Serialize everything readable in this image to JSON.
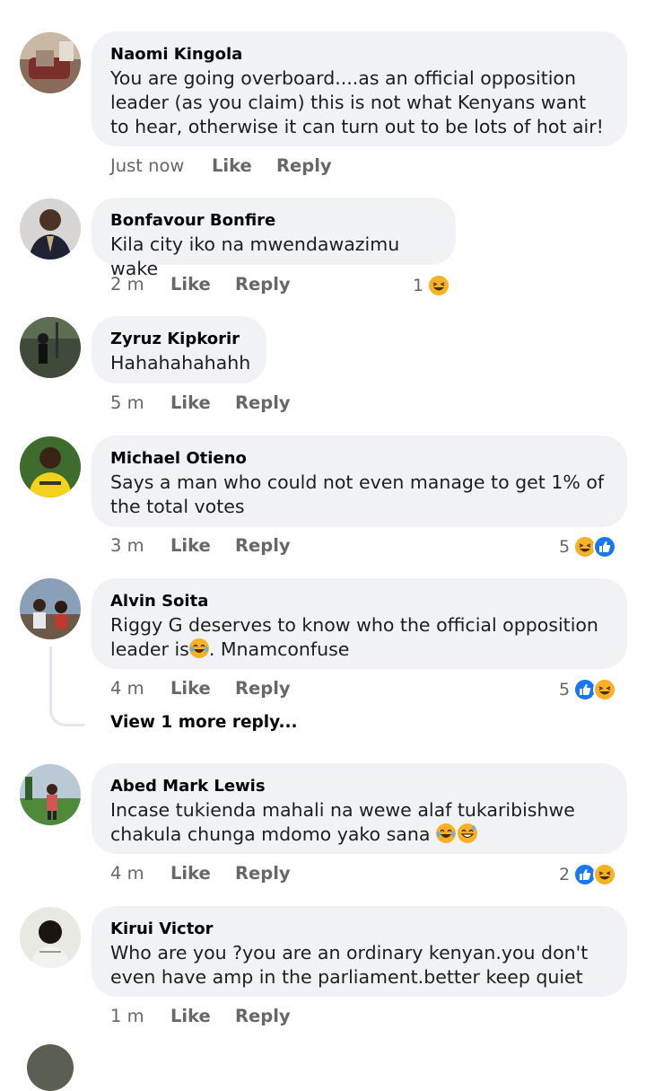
{
  "comments": [
    {
      "author": "Naomi Kingola",
      "text": "You are going overboard....as an official opposition leader (as you claim) this is not what Kenyans want to hear, otherwise it can turn out to be lots of hot air!",
      "time": "Just now",
      "like": "Like",
      "reply": "Reply"
    },
    {
      "author": "Bonfavour Bonfire",
      "text": "Kila city iko na mwendawazimu wake",
      "time": "2 m",
      "like": "Like",
      "reply": "Reply",
      "reaction_count": "1"
    },
    {
      "author": "Zyruz Kipkorir",
      "text": "Hahahahahahh",
      "time": "5 m",
      "like": "Like",
      "reply": "Reply"
    },
    {
      "author": "Michael Otieno",
      "text": "Says a man who could not even manage to get 1% of the total votes",
      "time": "3 m",
      "like": "Like",
      "reply": "Reply",
      "reaction_count": "5"
    },
    {
      "author": "Alvin Soita",
      "text_before_emoji": "Riggy G deserves to know who the official opposition leader is",
      "text_after_emoji": ". Mnamconfuse",
      "time": "4 m",
      "like": "Like",
      "reply": "Reply",
      "reaction_count": "5",
      "view_more": "View 1 more reply..."
    },
    {
      "author": "Abed Mark Lewis",
      "text": "Incase tukienda mahali na wewe alaf tukaribishwe chakula chunga mdomo yako sana ",
      "time": "4 m",
      "like": "Like",
      "reply": "Reply",
      "reaction_count": "2"
    },
    {
      "author": "Kirui Victor",
      "text": "Who are you ?you are an ordinary kenyan.you don't even have amp in the parliament.better keep quiet",
      "time": "1 m",
      "like": "Like",
      "reply": "Reply"
    }
  ],
  "icons": {
    "like_reaction": "like-reaction-icon",
    "haha_reaction": "haha-reaction-icon",
    "laugh_tears_emoji": "laughing-tears-emoji",
    "grin_sweat_emoji": "grin-sweat-emoji"
  },
  "colors": {
    "bubble": "#f0f2f5",
    "secondary_text": "#65676b",
    "like_blue": "#1877f2",
    "haha_yellow": "#f7b125"
  }
}
